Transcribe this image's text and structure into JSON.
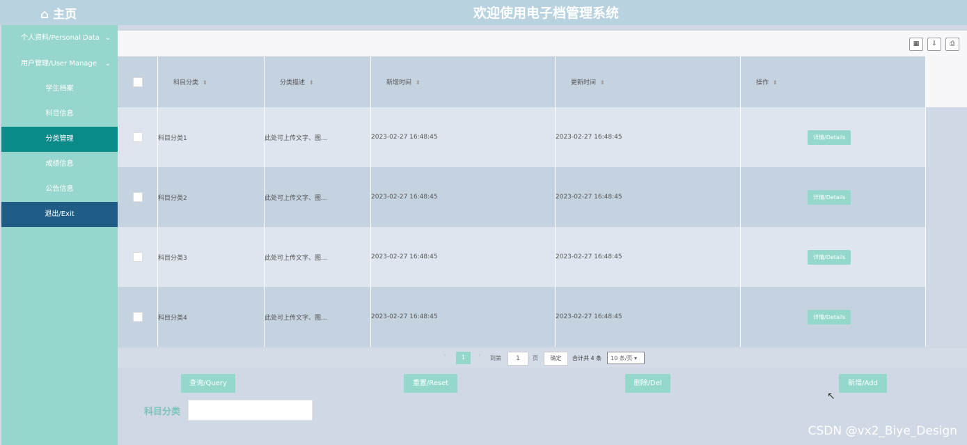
{
  "header": {
    "home_label": "⌂ 主页",
    "title": "欢迎使用电子档管理系统"
  },
  "sidebar": {
    "groups": [
      {
        "label": "个人资料/Personal Data",
        "chevron": "⌄"
      },
      {
        "label": "用户管理/User Manage",
        "chevron": "⌄"
      }
    ],
    "items": [
      {
        "label": "学生档案"
      },
      {
        "label": "科目信息"
      },
      {
        "label": "分类管理"
      },
      {
        "label": "成绩信息"
      },
      {
        "label": "公告信息"
      },
      {
        "label": "退出/Exit"
      }
    ]
  },
  "toolbar": {
    "icons": [
      "columns-icon",
      "export-icon",
      "print-icon"
    ]
  },
  "table": {
    "columns": [
      "科目分类",
      "分类描述",
      "新增时间",
      "更新时间",
      "操作"
    ],
    "rows": [
      {
        "category": "科目分类1",
        "desc": "此处可上传文字、图...",
        "created": "2023-02-27 16:48:45",
        "updated": "2023-02-27 16:48:45",
        "action": "详情/Details"
      },
      {
        "category": "科目分类2",
        "desc": "此处可上传文字、图...",
        "created": "2023-02-27 16:48:45",
        "updated": "2023-02-27 16:48:45",
        "action": "详情/Details"
      },
      {
        "category": "科目分类3",
        "desc": "此处可上传文字、图...",
        "created": "2023-02-27 16:48:45",
        "updated": "2023-02-27 16:48:45",
        "action": "详情/Details"
      },
      {
        "category": "科目分类4",
        "desc": "此处可上传文字、图...",
        "created": "2023-02-27 16:48:45",
        "updated": "2023-02-27 16:48:45",
        "action": "详情/Details"
      }
    ]
  },
  "pager": {
    "prev": "‹",
    "current": "1",
    "next": "›",
    "goto_label": "到第",
    "goto_value": "1",
    "page_unit": "页",
    "confirm": "确定",
    "total": "合计共 4 条",
    "page_size": "10 条/页"
  },
  "actions": {
    "query": "查询/Query",
    "reset": "重置/Reset",
    "delete": "删除/Del",
    "add": "新增/Add"
  },
  "filter": {
    "label": "科目分类",
    "value": ""
  },
  "watermark": "CSDN @vx2_Biye_Design",
  "colors": {
    "accent": "#93d8cb",
    "sidebar": "#96d6cc",
    "active": "#0b8a8a",
    "exit": "#1f5c86"
  }
}
